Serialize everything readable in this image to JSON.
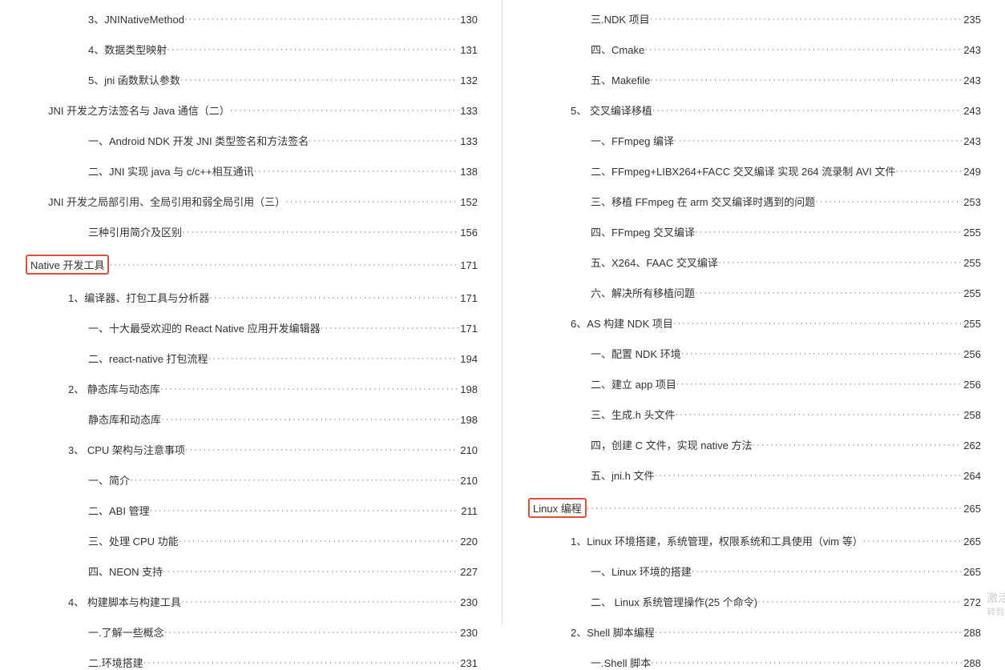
{
  "left_page": [
    {
      "indent": 3,
      "label": "3、JNINativeMethod",
      "page": "130",
      "highlight": false
    },
    {
      "indent": 3,
      "label": "4、数据类型映射",
      "page": "131",
      "highlight": false
    },
    {
      "indent": 3,
      "label": "5、jni 函数默认参数",
      "page": "132",
      "highlight": false
    },
    {
      "indent": 1,
      "label": "JNI 开发之方法签名与 Java 通信（二）",
      "page": "133",
      "highlight": false
    },
    {
      "indent": 3,
      "label": "一、Android NDK 开发  JNI 类型签名和方法签名",
      "page": "133",
      "highlight": false
    },
    {
      "indent": 3,
      "label": "二、JNI 实现 java 与 c/c++相互通讯",
      "page": "138",
      "highlight": false
    },
    {
      "indent": 1,
      "label": "JNI 开发之局部引用、全局引用和弱全局引用（三）",
      "page": "152",
      "highlight": false
    },
    {
      "indent": 3,
      "label": "三种引用简介及区别",
      "page": "156",
      "highlight": false
    },
    {
      "indent": 0,
      "label": "Native 开发工具",
      "page": "171",
      "highlight": true
    },
    {
      "indent": 2,
      "label": "1、编译器、打包工具与分析器",
      "page": "171",
      "highlight": false
    },
    {
      "indent": 3,
      "label": "一、十大最受欢迎的  React Native  应用开发编辑器",
      "page": "171",
      "highlight": false
    },
    {
      "indent": 3,
      "label": "二、react-native  打包流程",
      "page": "194",
      "highlight": false
    },
    {
      "indent": 2,
      "label": "2、 静态库与动态库",
      "page": "198",
      "highlight": false
    },
    {
      "indent": 3,
      "label": "静态库和动态库",
      "page": "198",
      "highlight": false
    },
    {
      "indent": 2,
      "label": "3、 CPU 架构与注意事项",
      "page": "210",
      "highlight": false
    },
    {
      "indent": 3,
      "label": "一、简介",
      "page": "210",
      "highlight": false
    },
    {
      "indent": 3,
      "label": "二、ABI  管理",
      "page": "211",
      "highlight": false
    },
    {
      "indent": 3,
      "label": "三、处理 CPU 功能",
      "page": "220",
      "highlight": false
    },
    {
      "indent": 3,
      "label": "四、NEON  支持",
      "page": "227",
      "highlight": false
    },
    {
      "indent": 2,
      "label": "4、 构建脚本与构建工具",
      "page": "230",
      "highlight": false
    },
    {
      "indent": 3,
      "label": "一.了解一些概念",
      "page": "230",
      "highlight": false
    },
    {
      "indent": 3,
      "label": "二.环境搭建",
      "page": "231",
      "highlight": false
    }
  ],
  "right_page": [
    {
      "indent": 3,
      "label": "三.NDK 项目",
      "page": "235",
      "highlight": false
    },
    {
      "indent": 3,
      "label": "四、Cmake",
      "page": "243",
      "highlight": false
    },
    {
      "indent": 3,
      "label": "五、Makefile",
      "page": "243",
      "highlight": false
    },
    {
      "indent": 2,
      "label": "5、 交叉编译移植",
      "page": "243",
      "highlight": false
    },
    {
      "indent": 3,
      "label": "一、FFmpeg  编译",
      "page": "243",
      "highlight": false
    },
    {
      "indent": 3,
      "label": "二、FFmpeg+LIBX264+FACC 交叉编译  实现 264 流录制 AVI 文件",
      "page": "249",
      "highlight": false
    },
    {
      "indent": 3,
      "label": "三、移植 FFmpeg 在 arm 交叉编译时遇到的问题",
      "page": "253",
      "highlight": false
    },
    {
      "indent": 3,
      "label": "四、FFmpeg 交叉编译",
      "page": "255",
      "highlight": false
    },
    {
      "indent": 3,
      "label": "五、X264、FAAC 交叉编译",
      "page": "255",
      "highlight": false
    },
    {
      "indent": 3,
      "label": "六、解决所有移植问题",
      "page": "255",
      "highlight": false
    },
    {
      "indent": 2,
      "label": "6、AS 构建 NDK 项目",
      "page": "255",
      "highlight": false
    },
    {
      "indent": 3,
      "label": "一、配置 NDK 环境",
      "page": "256",
      "highlight": false
    },
    {
      "indent": 3,
      "label": "二、建立 app 项目",
      "page": "256",
      "highlight": false
    },
    {
      "indent": 3,
      "label": "三、生成.h 头文件",
      "page": "258",
      "highlight": false
    },
    {
      "indent": 3,
      "label": "四，创建 C 文件，实现 native 方法",
      "page": "262",
      "highlight": false
    },
    {
      "indent": 3,
      "label": "五、jni.h 文件",
      "page": "264",
      "highlight": false
    },
    {
      "indent": 0,
      "label": "Linux 编程",
      "page": "265",
      "highlight": true
    },
    {
      "indent": 2,
      "label": "1、Linux 环境搭建，系统管理，权限系统和工具使用（vim 等）",
      "page": "265",
      "highlight": false
    },
    {
      "indent": 3,
      "label": "一、Linux 环境的搭建",
      "page": "265",
      "highlight": false
    },
    {
      "indent": 3,
      "label": "二、 Linux 系统管理操作(25 个命令)",
      "page": "272",
      "highlight": false
    },
    {
      "indent": 2,
      "label": "2、Shell 脚本编程",
      "page": "288",
      "highlight": false
    },
    {
      "indent": 3,
      "label": "一.Shell 脚本",
      "page": "288",
      "highlight": false
    }
  ],
  "watermark": {
    "line1": "激活 Win",
    "line2": "转到\"设置\"以"
  }
}
